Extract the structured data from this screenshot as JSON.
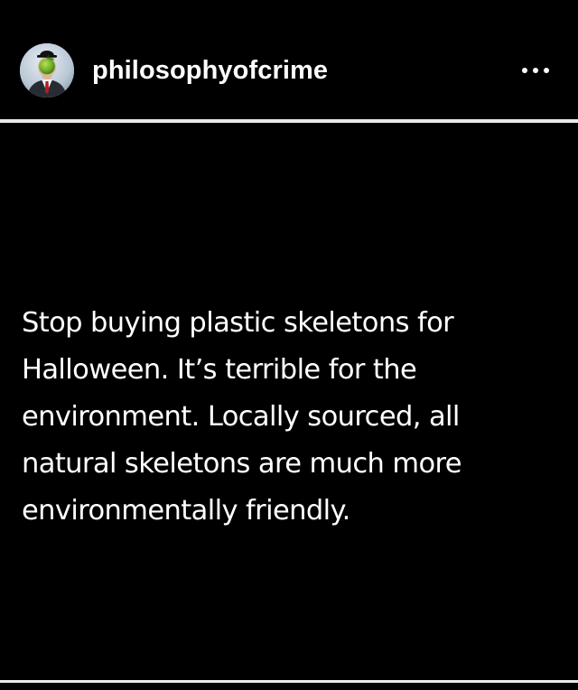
{
  "post": {
    "username": "philosophyofcrime",
    "avatar_icon": "man-in-bowler-hat-with-apple-avatar",
    "more_icon": "ellipsis-icon",
    "text_lines": [
      "Stop buying plastic skeletons for",
      "Halloween. It’s terrible for the",
      "environment. Locally sourced, all",
      "natural skeletons are much more",
      "environmentally friendly."
    ]
  },
  "colors": {
    "background": "#000000",
    "text": "#ffffff",
    "divider": "#e9e9e9"
  }
}
